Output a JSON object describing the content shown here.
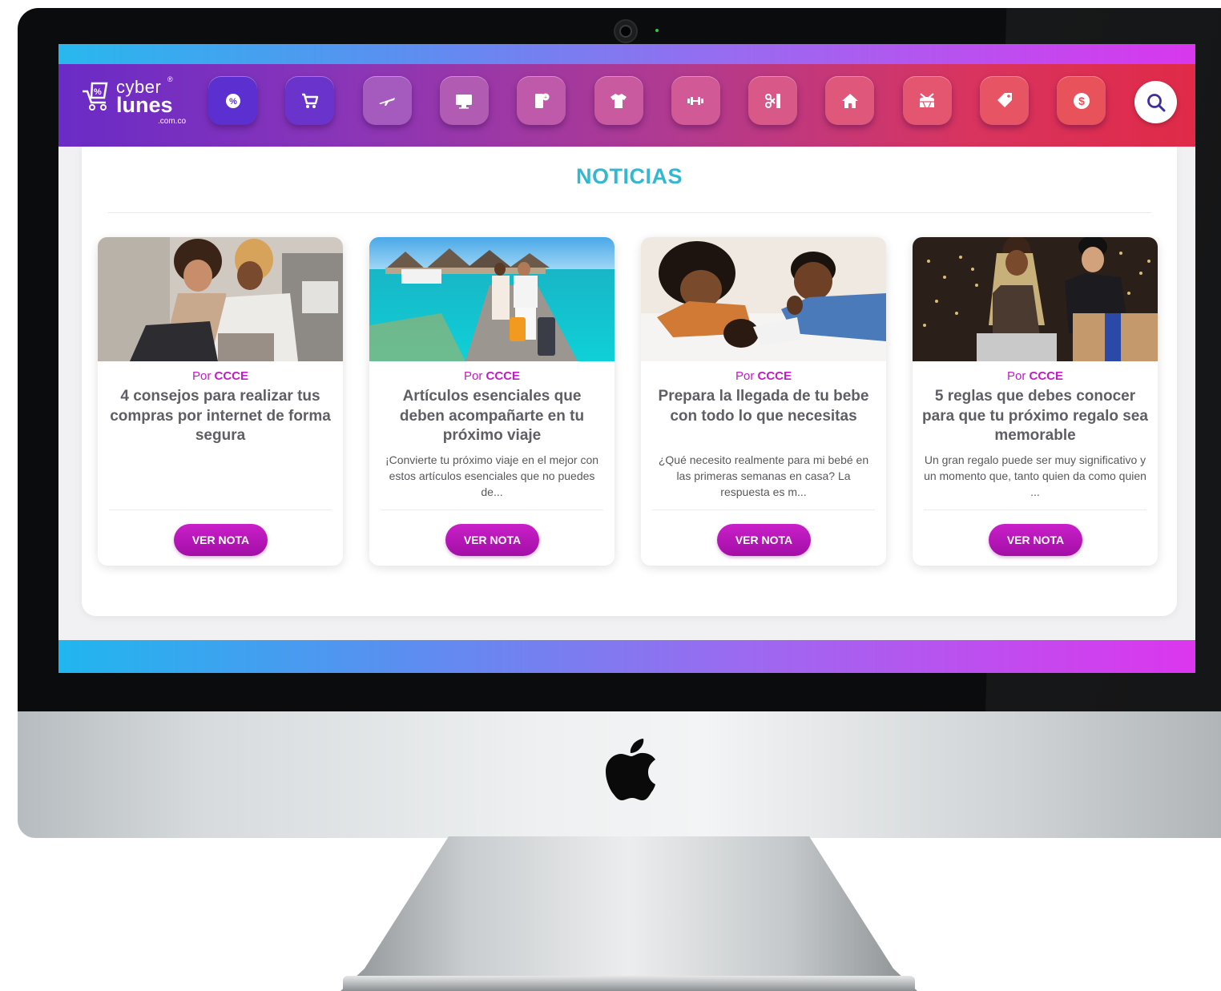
{
  "brand": {
    "cyber": "cyber",
    "registered": "®",
    "lunes": "lunes",
    "domain": ".com.co"
  },
  "nav": [
    {
      "icon": "discount-percent-icon",
      "bg": "#5b2fd0"
    },
    {
      "icon": "shopping-cart-icon",
      "bg": "#6a33cc"
    },
    {
      "icon": "airplane-icon",
      "bg": "#a55bbd"
    },
    {
      "icon": "monitor-icon",
      "bg": "#b25bb3"
    },
    {
      "icon": "appliances-icon",
      "bg": "#be5aa9"
    },
    {
      "icon": "tshirt-icon",
      "bg": "#c95a9f"
    },
    {
      "icon": "dumbbell-icon",
      "bg": "#d15995"
    },
    {
      "icon": "beauty-scissors-icon",
      "bg": "#d85888"
    },
    {
      "icon": "home-icon",
      "bg": "#df577b"
    },
    {
      "icon": "toys-drum-icon",
      "bg": "#e4566f"
    },
    {
      "icon": "price-tag-icon",
      "bg": "#e75564"
    },
    {
      "icon": "dollar-icon",
      "bg": "#e8525a"
    }
  ],
  "search": {
    "icon": "search-icon"
  },
  "section": {
    "title": "NOTICIAS"
  },
  "cards": [
    {
      "by_prefix": "Por",
      "author": "CCCE",
      "title": "4 consejos para realizar tus compras por internet de forma segura",
      "excerpt": "",
      "button": "VER NOTA",
      "image": "couple-laptop-photo"
    },
    {
      "by_prefix": "Por",
      "author": "CCCE",
      "title": "Artículos esenciales que deben acompañarte en tu próximo viaje",
      "excerpt": "¡Convierte tu próximo viaje en el mejor con estos artículos esenciales que no puedes de...",
      "button": "VER NOTA",
      "image": "travel-dock-photo"
    },
    {
      "by_prefix": "Por",
      "author": "CCCE",
      "title": "Prepara la llegada de tu bebe con todo lo que necesitas",
      "excerpt": "¿Qué necesito realmente para mi bebé en las primeras semanas en casa? La respuesta es m...",
      "button": "VER NOTA",
      "image": "parents-baby-photo"
    },
    {
      "by_prefix": "Por",
      "author": "CCCE",
      "title": "5 reglas que debes conocer para que tu próximo regalo sea memorable",
      "excerpt": "Un gran regalo puede ser muy significativo y un momento que, tanto quien da como quien ...",
      "button": "VER NOTA",
      "image": "gift-party-photo"
    }
  ],
  "colors": {
    "accent_title": "#34b8d0",
    "button": "#b514b8",
    "author": "#c31bc6"
  }
}
